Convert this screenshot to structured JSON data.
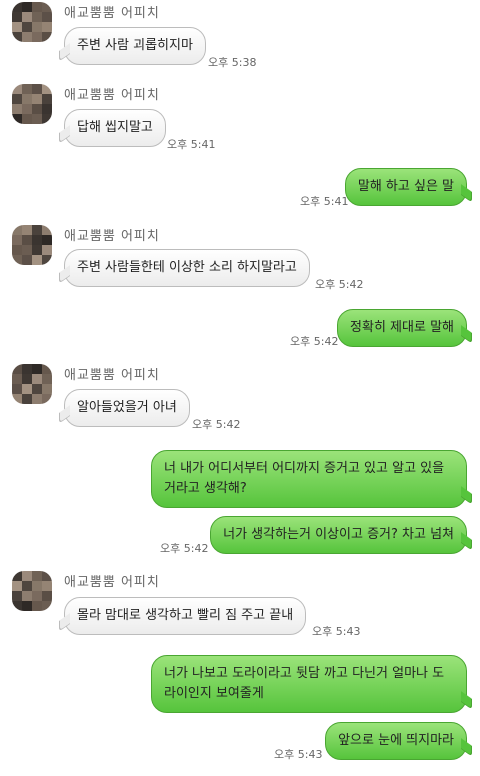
{
  "sender": {
    "name": "애교뿜뿜 어피치",
    "avatar_icon": "pixelated-avatar-icon"
  },
  "colors": {
    "incoming_bubble": "#f0f0f0",
    "outgoing_bubble": "#6fd14f"
  },
  "messages": [
    {
      "direction": "in",
      "show_sender": true,
      "text": "주변 사람 괴롭히지마",
      "time": "오후 5:38"
    },
    {
      "direction": "in",
      "show_sender": true,
      "text": "답해 씹지말고",
      "time": "오후 5:41"
    },
    {
      "direction": "out",
      "text": "말해 하고 싶은 말",
      "time": "오후 5:41"
    },
    {
      "direction": "in",
      "show_sender": true,
      "text": "주변 사람들한테 이상한 소리 하지말라고",
      "time": "오후 5:42"
    },
    {
      "direction": "out",
      "text": "정확히 제대로 말해",
      "time": "오후 5:42"
    },
    {
      "direction": "in",
      "show_sender": true,
      "text": "알아들었을거 아녀",
      "time": "오후 5:42"
    },
    {
      "direction": "out",
      "text": "너 내가 어디서부터 어디까지 증거고 있고 알고 있을거라고 생각해?",
      "time": ""
    },
    {
      "direction": "out",
      "text": "너가 생각하는거 이상이고 증거? 차고 넘쳐",
      "time": "오후 5:42"
    },
    {
      "direction": "in",
      "show_sender": true,
      "text": "몰라 맘대로 생각하고 빨리 짐 주고 끝내",
      "time": "오후 5:43"
    },
    {
      "direction": "out",
      "text": "너가 나보고 도라이라고 뒷담 까고 다닌거 얼마나 도라이인지 보여줄게",
      "time": ""
    },
    {
      "direction": "out",
      "text": "앞으로 눈에 띄지마라",
      "time": "오후 5:43"
    }
  ]
}
